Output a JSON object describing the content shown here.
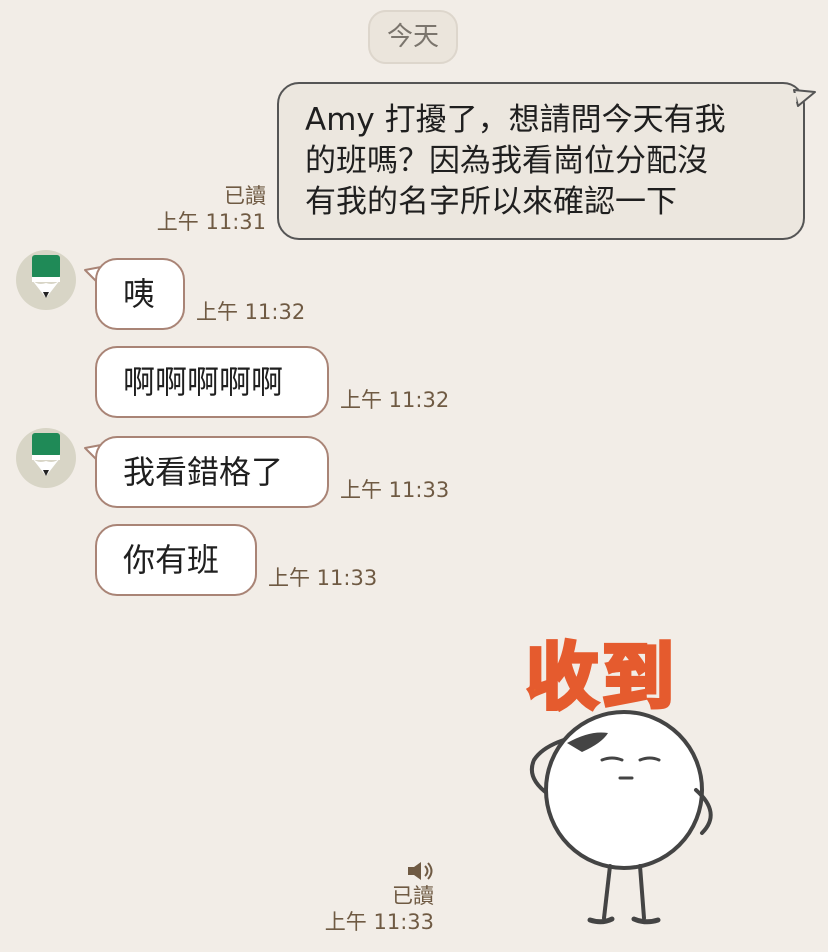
{
  "date_divider": "今天",
  "messages": [
    {
      "id": "m1",
      "from": "me",
      "text_lines": [
        "Amy 打擾了，想請問今天有我",
        "的班嗎？因為我看崗位分配沒",
        "有我的名字所以來確認一下"
      ],
      "read": "已讀",
      "time": "上午 11:31"
    },
    {
      "id": "m2",
      "from": "other",
      "text": "咦",
      "time": "上午 11:32",
      "show_avatar": true
    },
    {
      "id": "m3",
      "from": "other",
      "text": "啊啊啊啊啊",
      "time": "上午 11:32",
      "show_avatar": false
    },
    {
      "id": "m4",
      "from": "other",
      "text": "我看錯格了",
      "time": "上午 11:33",
      "show_avatar": true
    },
    {
      "id": "m5",
      "from": "other",
      "text": "你有班",
      "time": "上午 11:33",
      "show_avatar": false
    },
    {
      "id": "m6",
      "from": "me",
      "type": "sticker",
      "sticker_text": "收到",
      "sticker_icon": "salute-character",
      "read": "已讀",
      "time": "上午 11:33"
    }
  ],
  "colors": {
    "chat_background": "#f2ede7",
    "outgoing_bubble": "#ece7df",
    "incoming_bubble": "#ffffff",
    "bubble_border": "#a98476",
    "meta_text": "#6f5a43",
    "avatar_green": "#1f8a57",
    "sticker_orange": "#f5a21e"
  }
}
